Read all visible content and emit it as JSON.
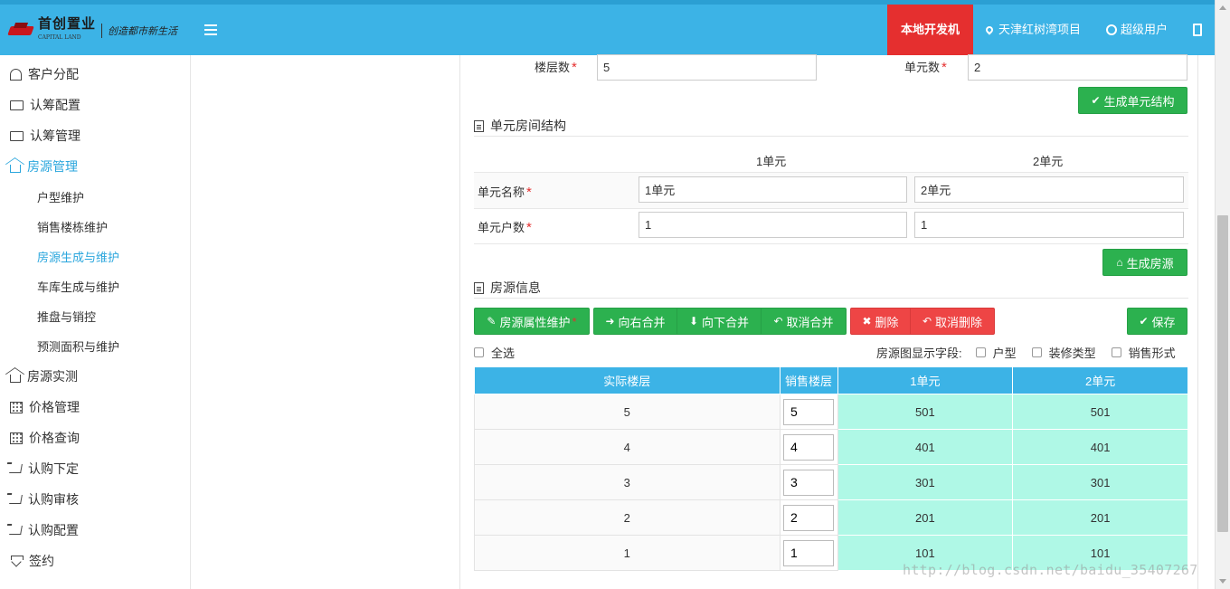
{
  "header": {
    "logo_title": "首创置业",
    "logo_subtitle": "CAPITAL LAND",
    "logo_slogan": "创造都市新生活",
    "env_badge": "本地开发机",
    "project": "天津红树湾项目",
    "user": "超级用户"
  },
  "sidebar": {
    "items": [
      {
        "label": "客户分配",
        "icon": "user-icon"
      },
      {
        "label": "认筹配置",
        "icon": "folder-icon"
      },
      {
        "label": "认筹管理",
        "icon": "folder-icon"
      },
      {
        "label": "房源管理",
        "icon": "home-icon",
        "active": true
      }
    ],
    "sub_items": [
      {
        "label": "户型维护"
      },
      {
        "label": "销售楼栋维护"
      },
      {
        "label": "房源生成与维护",
        "active": true
      },
      {
        "label": "车库生成与维护"
      },
      {
        "label": "推盘与销控"
      },
      {
        "label": "预测面积与维护"
      }
    ],
    "items_after": [
      {
        "label": "房源实测",
        "icon": "home-icon"
      },
      {
        "label": "价格管理",
        "icon": "calendar-icon"
      },
      {
        "label": "价格查询",
        "icon": "calendar-icon"
      },
      {
        "label": "认购下定",
        "icon": "cart-icon"
      },
      {
        "label": "认购审核",
        "icon": "cart-icon"
      },
      {
        "label": "认购配置",
        "icon": "cart-icon"
      },
      {
        "label": "签约",
        "icon": "diamond-icon"
      }
    ]
  },
  "form": {
    "floors_label": "楼层数",
    "floors_value": "5",
    "units_label": "单元数",
    "units_value": "2",
    "gen_units_btn": "生成单元结构"
  },
  "unit_section": {
    "title": "单元房间结构",
    "unit_headers": [
      "1单元",
      "2单元"
    ],
    "name_label": "单元名称",
    "name_values": [
      "1单元",
      "2单元"
    ],
    "count_label": "单元户数",
    "count_values": [
      "1",
      "1"
    ],
    "gen_rooms_btn": "生成房源"
  },
  "house_section": {
    "title": "房源信息",
    "btn_attr": "房源属性维护",
    "btn_merge_right": "向右合并",
    "btn_merge_down": "向下合并",
    "btn_cancel_merge": "取消合并",
    "btn_delete": "删除",
    "btn_cancel_delete": "取消删除",
    "btn_save": "保存",
    "select_all": "全选",
    "display_fields_label": "房源图显示字段:",
    "display_fields": [
      "户型",
      "装修类型",
      "销售形式"
    ],
    "table": {
      "headers": [
        "实际楼层",
        "销售楼层",
        "1单元",
        "2单元"
      ],
      "rows": [
        {
          "floor": "5",
          "sale_floor": "5",
          "u1": "501",
          "u2": "501"
        },
        {
          "floor": "4",
          "sale_floor": "4",
          "u1": "401",
          "u2": "401"
        },
        {
          "floor": "3",
          "sale_floor": "3",
          "u1": "301",
          "u2": "301"
        },
        {
          "floor": "2",
          "sale_floor": "2",
          "u1": "201",
          "u2": "201"
        },
        {
          "floor": "1",
          "sale_floor": "1",
          "u1": "101",
          "u2": "101"
        }
      ]
    }
  },
  "watermark": "http://blog.csdn.net/baidu_35407267",
  "colors": {
    "header": "#3cb3e6",
    "badge": "#e52f2f",
    "green": "#2cb14f",
    "red": "#ee4545",
    "cell": "#aff8e6"
  }
}
